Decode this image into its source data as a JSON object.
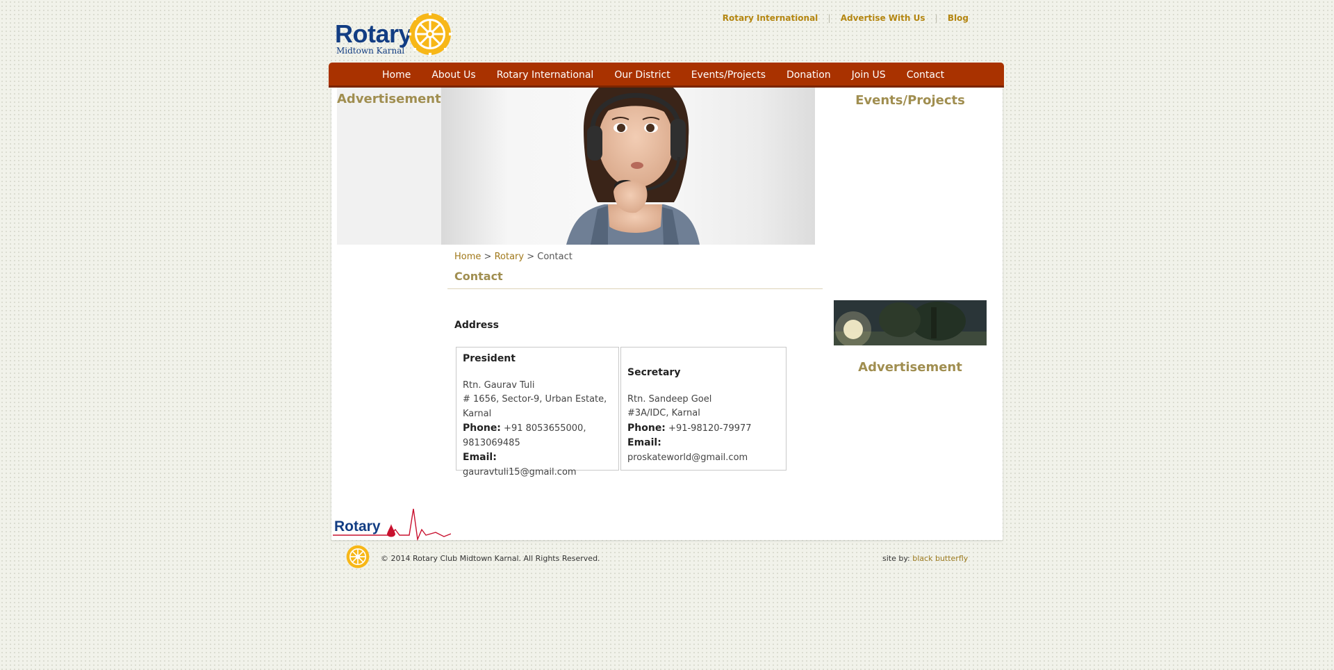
{
  "header": {
    "logo_text": "Rotary",
    "logo_subtext": "Midtown Karnal",
    "top_links": [
      "Rotary International",
      "Advertise With Us",
      "Blog"
    ],
    "top_link_separator": "|"
  },
  "nav": {
    "items": [
      "Home",
      "About Us",
      "Rotary International",
      "Our District",
      "Events/Projects",
      "Donation",
      "Join US",
      "Contact"
    ]
  },
  "left_sidebar": {
    "title": "Advertisement"
  },
  "right_sidebar": {
    "events_title": "Events/Projects",
    "ad_title": "Advertisement"
  },
  "breadcrumb": {
    "home": "Home",
    "sep": ">",
    "rotary": "Rotary",
    "current": "Contact"
  },
  "page": {
    "title": "Contact",
    "address_heading": "Address"
  },
  "contacts": {
    "president": {
      "role": "President",
      "name": "Rtn. Gaurav Tuli",
      "address": "# 1656, Sector-9, Urban Estate, Karnal",
      "phone_label": "Phone:",
      "phone": "+91 8053655000, 9813069485",
      "email_label": "Email:",
      "email": "gauravtuli15@gmail.com"
    },
    "secretary": {
      "role": "Secretary",
      "name": "Rtn. Sandeep Goel",
      "address": "#3A/IDC, Karnal",
      "phone_label": "Phone:",
      "phone": "+91-98120-79977",
      "email_label": "Email:",
      "email": "proskateworld@gmail.com"
    }
  },
  "footer": {
    "logo_text": "Rotary",
    "copyright": "© 2014 Rotary Club Midtown Karnal. All Rights Reserved.",
    "site_by_label": "site by:",
    "site_by_credit": "black butterfly"
  },
  "colors": {
    "nav_bg": "#a93200",
    "accent_gold": "#b48611",
    "heading_olive": "#a08e50",
    "rotary_blue": "#123d83",
    "rotary_yellow": "#f7b718"
  },
  "icons": [
    "rotary-wheel-icon",
    "heartbeat-line-icon",
    "blood-drop-icon"
  ]
}
